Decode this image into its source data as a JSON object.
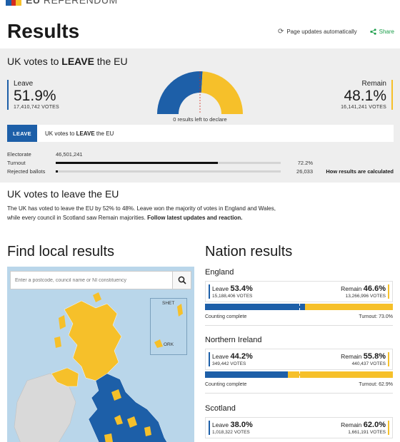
{
  "brand": {
    "name_bold": "EU",
    "name_light": "REFERENDUM"
  },
  "header": {
    "title": "Results",
    "auto_update": "Page updates automatically",
    "share": "Share"
  },
  "uk": {
    "heading_prefix": "UK votes to ",
    "heading_bold": "LEAVE",
    "heading_suffix": " the EU",
    "leave_label": "Leave",
    "leave_pct": "51.9%",
    "leave_votes": "17,410,742 VOTES",
    "leave_share": 51.9,
    "remain_label": "Remain",
    "remain_pct": "48.1%",
    "remain_votes": "16,141,241 VOTES",
    "left_to_declare": "0 results left to declare",
    "result_badge": "LEAVE",
    "result_prefix": "UK votes to ",
    "result_bold": "LEAVE",
    "result_suffix": " the EU",
    "electorate_label": "Electorate",
    "electorate_value": "46,501,241",
    "turnout_label": "Turnout",
    "turnout_value": "72.2%",
    "turnout_fraction": 0.722,
    "rejected_label": "Rejected ballots",
    "rejected_value": "26,033",
    "how_calculated": "How results are calculated"
  },
  "summary": {
    "heading": "UK votes to leave the EU",
    "body": "The UK has voted to leave the EU by 52% to 48%. Leave won the majority of votes in England and Wales, while every council in Scotland saw Remain majorities. ",
    "link": "Follow latest updates and reaction."
  },
  "local": {
    "title": "Find local results",
    "search_placeholder": "Enter a postcode, council name or NI constituency",
    "inset_shet": "SHET",
    "inset_ork": "ORK"
  },
  "nations": {
    "title": "Nation results",
    "counting_label": "Counting complete",
    "leave_word": "Leave",
    "remain_word": "Remain",
    "list": [
      {
        "name": "England",
        "leave_pct": "53.4%",
        "leave_votes": "15,188,406 VOTES",
        "remain_pct": "46.6%",
        "remain_votes": "13,266,996 VOTES",
        "turnout": "Turnout: 73.0%",
        "leave_share": 53.4
      },
      {
        "name": "Northern Ireland",
        "leave_pct": "44.2%",
        "leave_votes": "349,442 VOTES",
        "remain_pct": "55.8%",
        "remain_votes": "440,437 VOTES",
        "turnout": "Turnout: 62.9%",
        "leave_share": 44.2
      },
      {
        "name": "Scotland",
        "leave_pct": "38.0%",
        "leave_votes": "1,018,322 VOTES",
        "remain_pct": "62.0%",
        "remain_votes": "1,661,191 VOTES",
        "turnout": "",
        "leave_share": 38.0
      }
    ]
  },
  "colors": {
    "leave": "#1d5fa8",
    "remain": "#f6c02a"
  }
}
